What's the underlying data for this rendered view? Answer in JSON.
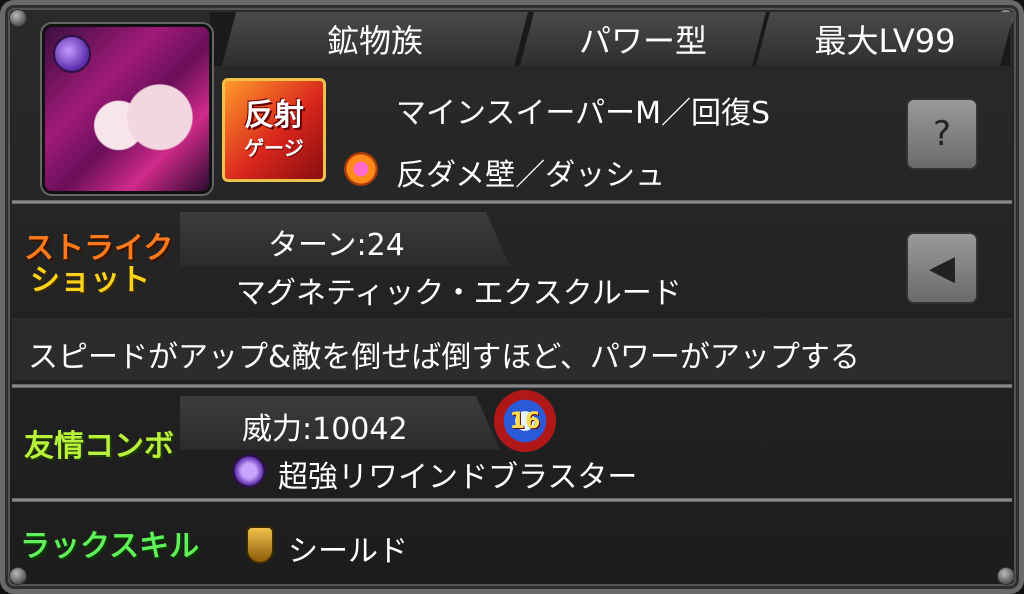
{
  "header": {
    "tribe": "鉱物族",
    "type": "パワー型",
    "max_level": "最大LV99"
  },
  "abilities": {
    "gauge_badge_top": "反射",
    "gauge_badge_bottom": "ゲージ",
    "main": "マインスイーパーM／回復S",
    "gauge": "反ダメ壁／ダッシュ"
  },
  "strike_shot": {
    "label_line1": "ストライク",
    "label_line2": "ショット",
    "turns": "ターン:24",
    "name": "マグネティック・エクスクルード",
    "description": "スピードがアップ&敵を倒せば倒すほど、パワーがアップする"
  },
  "friendship_combo": {
    "label": "友情コンボ",
    "power": "威力:10042",
    "hits": "16",
    "name": "超強リワインドブラスター"
  },
  "luck_skill": {
    "label": "ラックスキル",
    "name": "シールド"
  },
  "colors": {
    "strike_label": "#ff7a1a",
    "friendship_label": "#b8f23a",
    "luck_label": "#5ff05a"
  }
}
